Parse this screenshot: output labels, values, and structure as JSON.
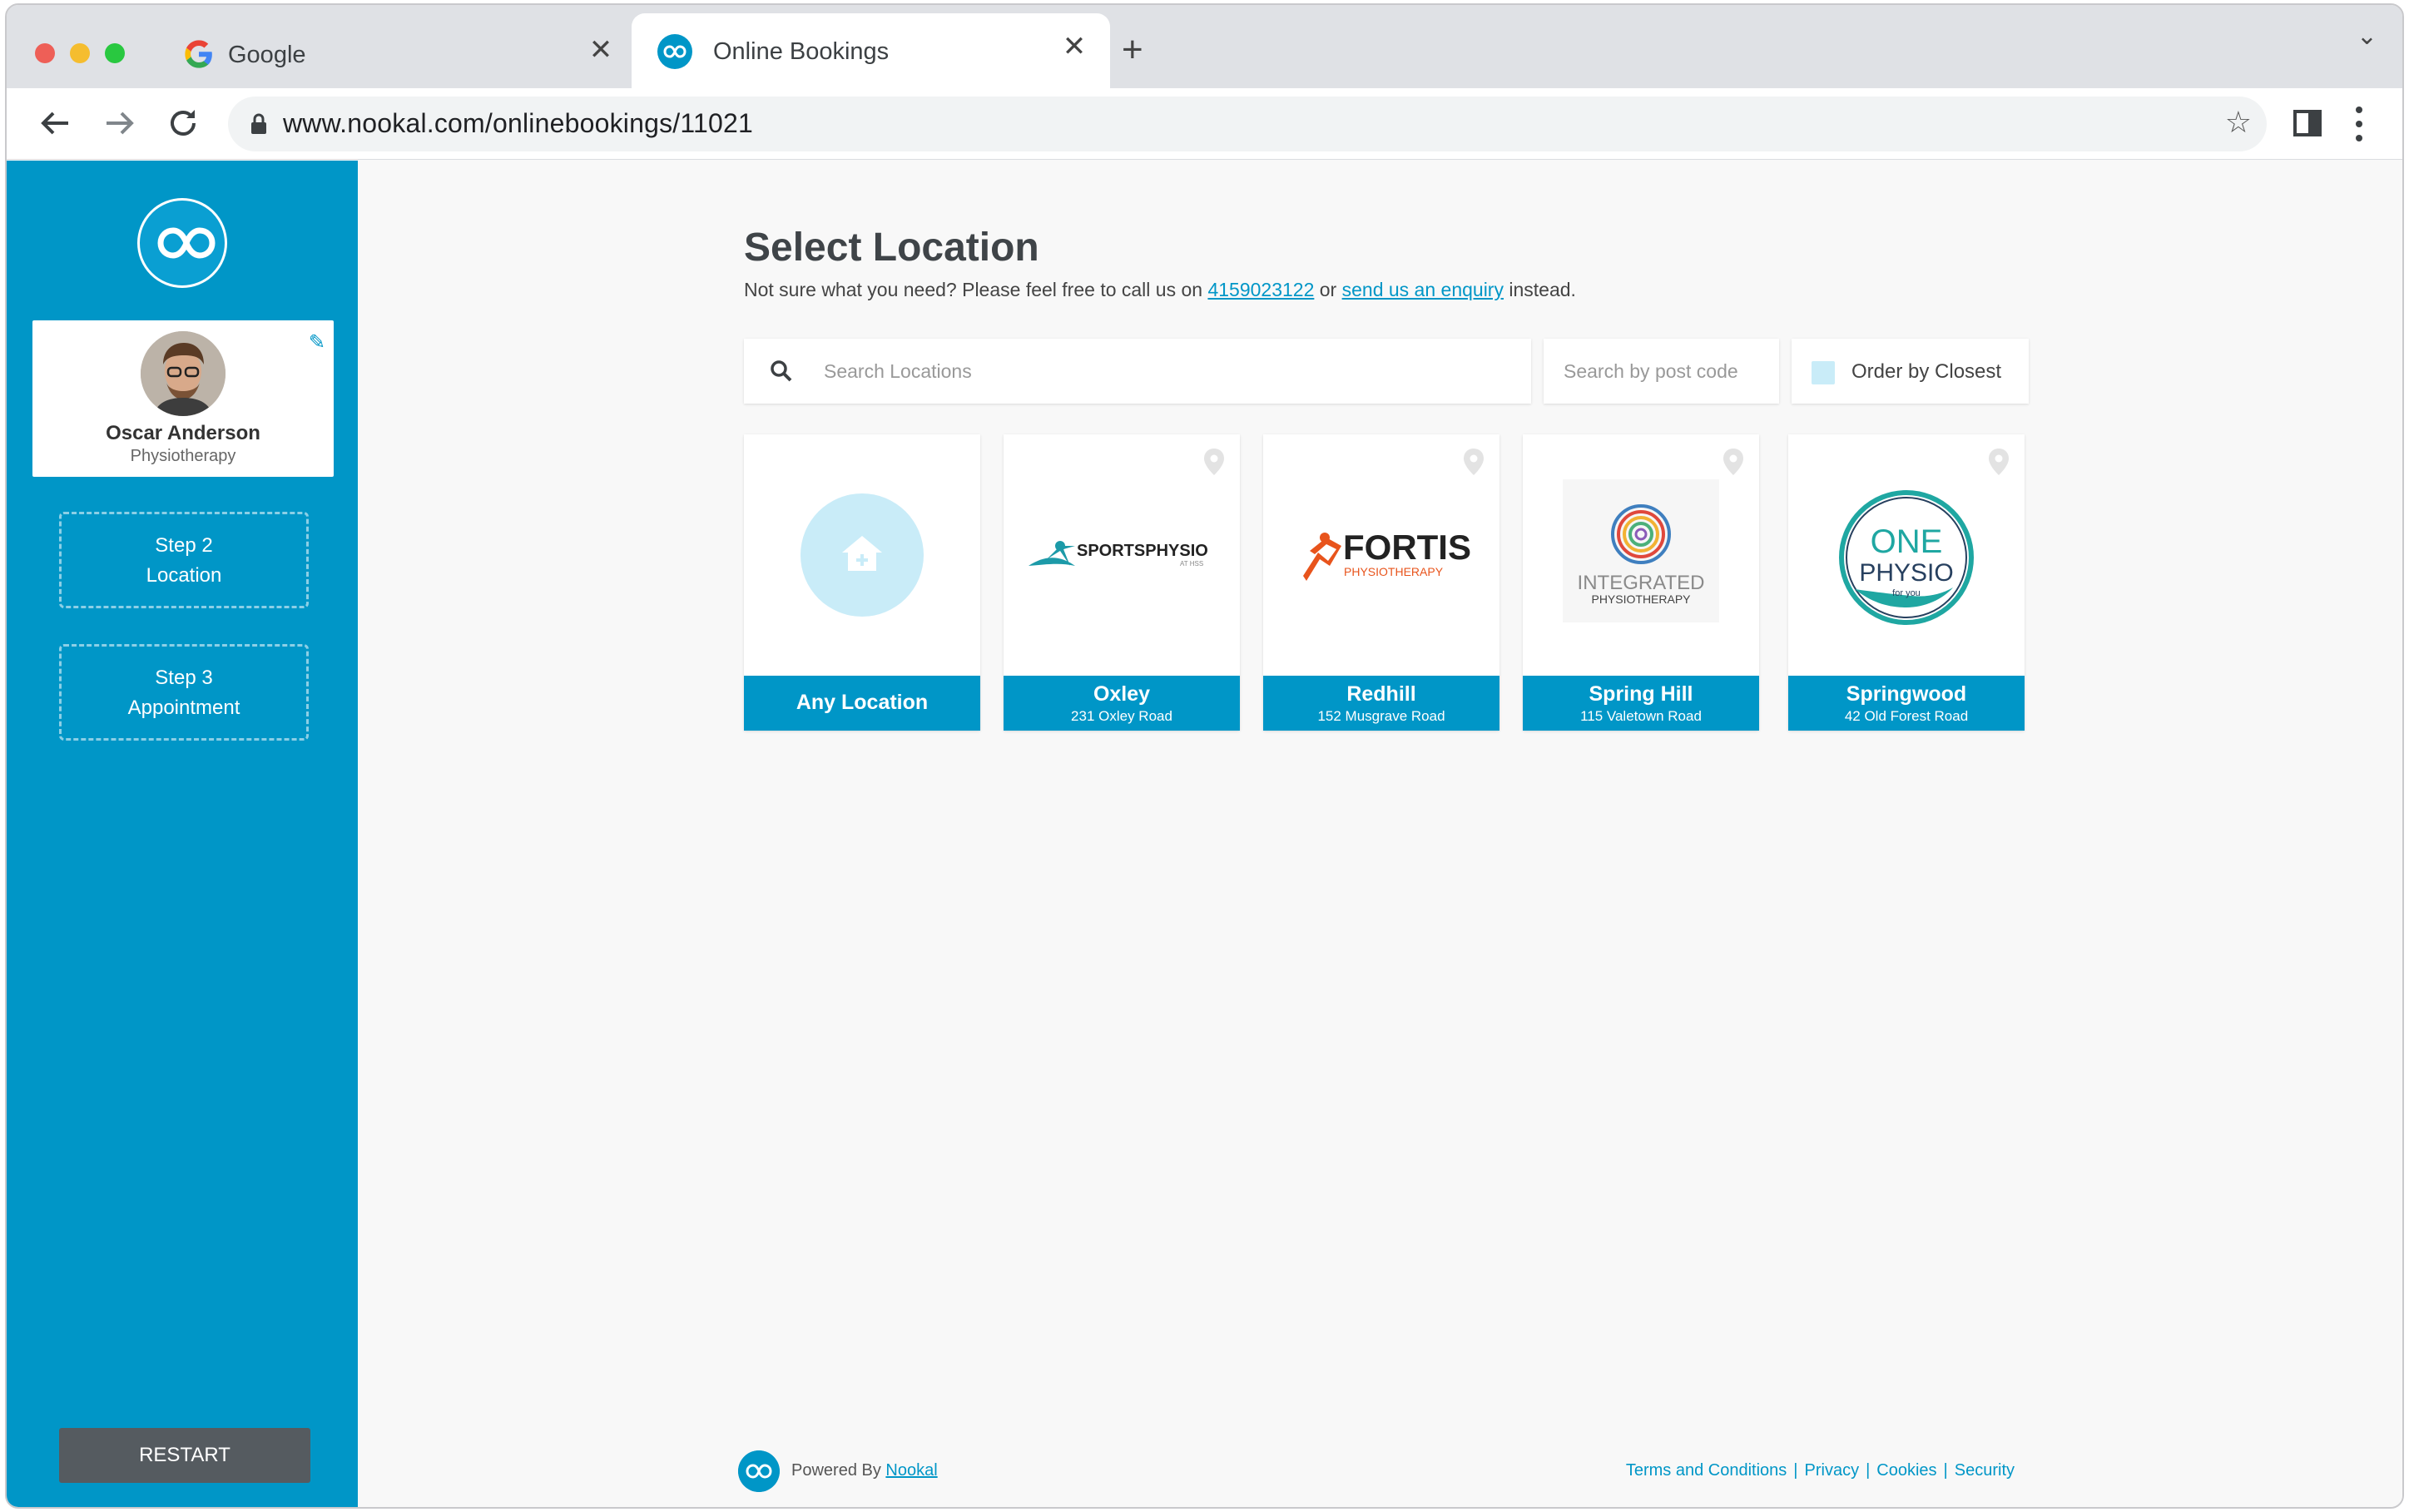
{
  "browser": {
    "tabs": [
      {
        "title": "Google",
        "active": false,
        "favicon": "google-g-icon"
      },
      {
        "title": "Online Bookings",
        "active": true,
        "favicon": "nookal-infinity-icon"
      }
    ],
    "url": "www.nookal.com/onlinebookings/11021"
  },
  "sidebar": {
    "profile": {
      "name": "Oscar Anderson",
      "service": "Physiotherapy"
    },
    "steps": [
      {
        "label": "Step 2",
        "sublabel": "Location"
      },
      {
        "label": "Step 3",
        "sublabel": "Appointment"
      }
    ],
    "restart_label": "RESTART"
  },
  "main": {
    "title": "Select Location",
    "subtitle": {
      "prefix": "Not sure what you need? Please feel free to call us on",
      "phone": "4159023122",
      "middle": "or",
      "enquiry_link": "send us an enquiry",
      "suffix": "instead."
    },
    "search": {
      "placeholder": "Search Locations",
      "value": ""
    },
    "postcode": {
      "placeholder": "Search by post code",
      "value": ""
    },
    "order_by_closest": {
      "label": "Order by Closest",
      "checked": false
    },
    "locations": [
      {
        "name": "Any Location",
        "address": "",
        "logo": "home-plus-icon"
      },
      {
        "name": "Oxley",
        "address": "231 Oxley Road",
        "logo_text": "SPORTSPHYSIO",
        "logo_sub": "AT HSS"
      },
      {
        "name": "Redhill",
        "address": "152 Musgrave Road",
        "logo_text": "FORTIS",
        "logo_sub": "PHYSIOTHERAPY"
      },
      {
        "name": "Spring Hill",
        "address": "115 Valetown Road",
        "logo_text": "INTEGRATED",
        "logo_sub": "PHYSIOTHERAPY"
      },
      {
        "name": "Springwood",
        "address": "42 Old Forest Road",
        "logo_text": "ONE",
        "logo_mid": "PHYSIO",
        "logo_sub": "for you"
      }
    ]
  },
  "footer": {
    "powered_by": "Powered By",
    "brand_link": "Nookal",
    "links": [
      "Terms and Conditions",
      "Privacy",
      "Cookies",
      "Security"
    ]
  },
  "colors": {
    "brand": "#0096c7",
    "sidebar": "#0096c7",
    "restart_button": "#555b60",
    "page_background": "#f8f8f8"
  }
}
